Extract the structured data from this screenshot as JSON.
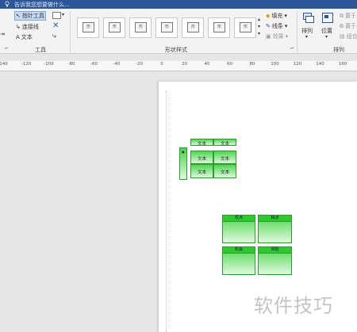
{
  "topbar": {
    "tell_me": "告诉我您想要做什么..."
  },
  "tools_group": {
    "pointer": "指针工具",
    "connector": "连接线",
    "text": "文本",
    "label": "工具"
  },
  "shape_styles": {
    "thumb_label": "形",
    "label": "形状样式",
    "fill": "填充",
    "line": "线条",
    "effect": "效果"
  },
  "arrange_group": {
    "arrange": "排列",
    "position": "位置",
    "label": "排列",
    "align_top": "置于",
    "align_bottom": "置于",
    "group": "组合"
  },
  "ruler": {
    "labels": [
      "140",
      "-120",
      "-100",
      "-80",
      "-60",
      "-40",
      "-20",
      "0",
      "20",
      "40",
      "60",
      "80",
      "100",
      "120",
      "140",
      "160"
    ]
  },
  "diagram1": {
    "cell_text": "文本"
  },
  "diagram2": {
    "top_left": "优点",
    "top_right": "缺点",
    "bottom_left": "机会",
    "bottom_right": "风险"
  },
  "watermark": "软件技巧"
}
